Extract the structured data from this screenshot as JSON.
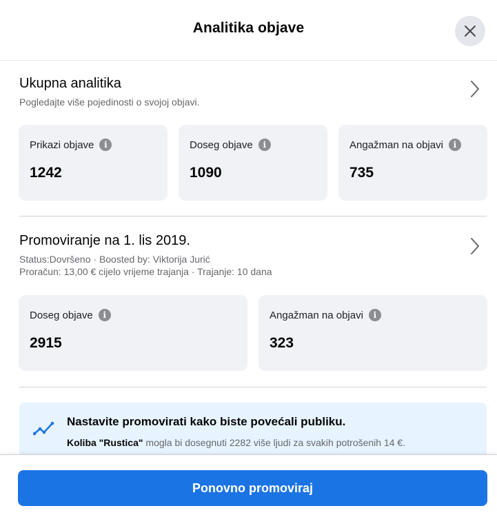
{
  "header": {
    "title": "Analitika objave",
    "close_icon": "close-icon"
  },
  "overall": {
    "title": "Ukupna analitika",
    "subtitle": "Pogledajte više pojedinosti o svojoj objavi.",
    "metrics": [
      {
        "label": "Prikazi objave",
        "value": "1242"
      },
      {
        "label": "Doseg objave",
        "value": "1090"
      },
      {
        "label": "Angažman na objavi",
        "value": "735"
      }
    ]
  },
  "promotion": {
    "title": "Promoviranje na 1. lis 2019.",
    "status_line": "Status:Dovršeno · Boosted by: Viktorija Jurić",
    "budget_line": "Proračun: 13,00 € cijelo vrijeme trajanja · Trajanje: 10 dana",
    "metrics": [
      {
        "label": "Doseg objave",
        "value": "2915"
      },
      {
        "label": "Angažman na objavi",
        "value": "323"
      }
    ]
  },
  "tip": {
    "title": "Nastavite promovirati kako biste povećali publiku.",
    "bold_part": "Koliba \"Rustica\"",
    "rest": " mogla bi dosegnuti 2282 više ljudi za svakih potrošenih 14 €."
  },
  "footer": {
    "button_label": "Ponovno promoviraj"
  },
  "colors": {
    "accent": "#1b74e4",
    "card_bg": "#f0f2f5",
    "tip_bg": "#e7f3ff"
  }
}
